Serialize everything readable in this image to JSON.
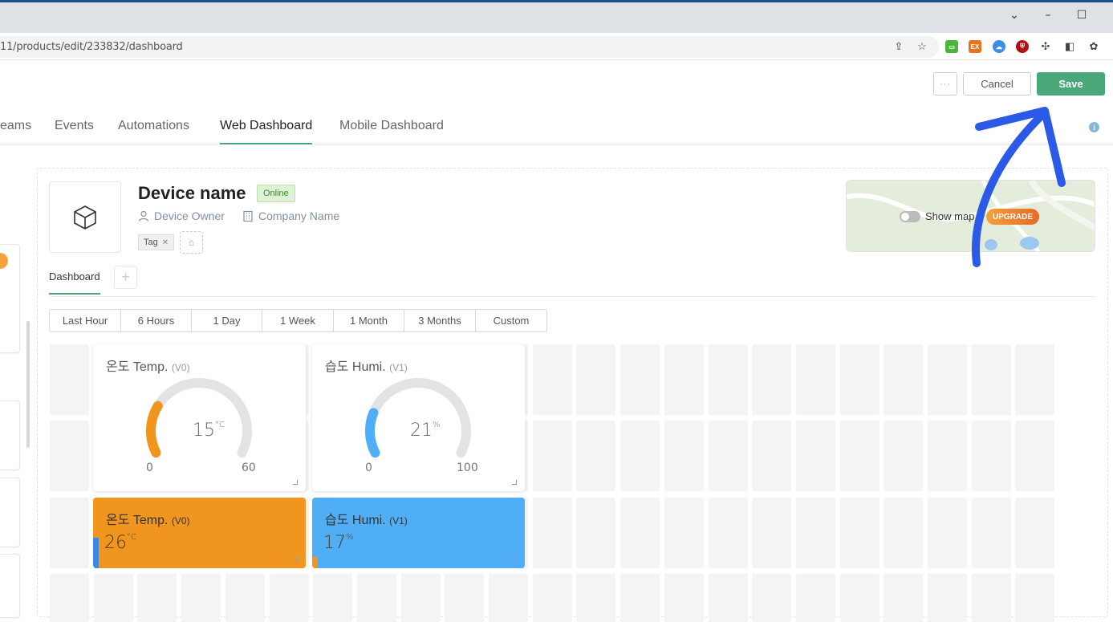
{
  "browser": {
    "url": "11/products/edit/233832/dashboard",
    "window_controls": [
      "chevron-down",
      "minimize",
      "maximize"
    ]
  },
  "header": {
    "more_label": "···",
    "cancel_label": "Cancel",
    "save_label": "Save"
  },
  "tabs": [
    {
      "label": "eams",
      "active": false
    },
    {
      "label": "Events",
      "active": false
    },
    {
      "label": "Automations",
      "active": false
    },
    {
      "label": "Web Dashboard",
      "active": true
    },
    {
      "label": "Mobile Dashboard",
      "active": false
    }
  ],
  "device": {
    "name": "Device name",
    "status": "Online",
    "owner": "Device Owner",
    "company": "Company Name",
    "tag": "Tag"
  },
  "map": {
    "label": "Show map",
    "upgrade": "UPGRADE"
  },
  "dashboard_tab": "Dashboard",
  "time_ranges": [
    {
      "label": "Last Hour",
      "selected": true
    },
    {
      "label": "6 Hours",
      "selected": false
    },
    {
      "label": "1 Day",
      "selected": false
    },
    {
      "label": "1 Week",
      "selected": false
    },
    {
      "label": "1 Month",
      "selected": false
    },
    {
      "label": "3 Months",
      "selected": false
    },
    {
      "label": "Custom",
      "selected": false
    }
  ],
  "gauges": [
    {
      "title": "온도 Temp.",
      "pin": "(V0)",
      "value": "15",
      "unit": "°C",
      "min": "0",
      "max": "60",
      "fraction": 0.25,
      "color": "#f0961e"
    },
    {
      "title": "습도 Humi.",
      "pin": "(V1)",
      "value": "21",
      "unit": "%",
      "min": "0",
      "max": "100",
      "fraction": 0.21,
      "color": "#4faef5"
    }
  ],
  "values": [
    {
      "title": "온도 Temp.",
      "pin": "(V0)",
      "value": "26",
      "unit": "°C",
      "color": "#f0961e",
      "bar": "#3b8be0"
    },
    {
      "title": "습도 Humi.",
      "pin": "(V1)",
      "value": "17",
      "unit": "%",
      "color": "#4faef5",
      "bar": "#f0961e"
    }
  ],
  "colors": {
    "accent": "#4aa77a",
    "annotation_arrow": "#2b59e8"
  }
}
